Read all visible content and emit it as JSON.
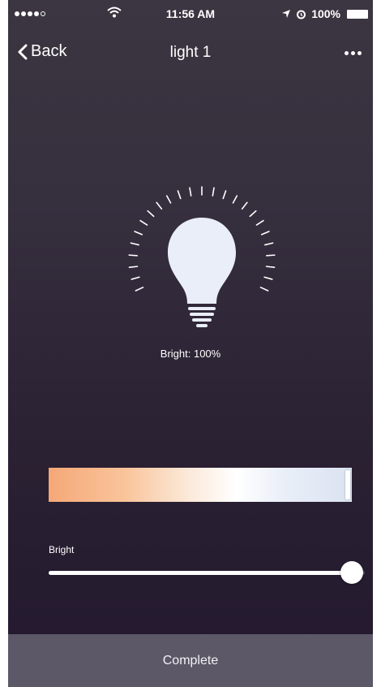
{
  "status_bar": {
    "signal_bars": 4,
    "signal_max": 5,
    "time": "11:56 AM",
    "battery": "100%"
  },
  "nav": {
    "back_label": "Back",
    "title": "light 1",
    "more_icon": "more-icon"
  },
  "bulb": {
    "brightness_text": "Bright: 100%",
    "color": "#e9eef8"
  },
  "color_temperature": {
    "gradient_start": "#f5a878",
    "gradient_end": "#dbe3f1",
    "selected_fraction": 1.0
  },
  "brightness_slider": {
    "label": "Bright",
    "value_fraction": 0.96
  },
  "footer": {
    "complete_label": "Complete"
  }
}
